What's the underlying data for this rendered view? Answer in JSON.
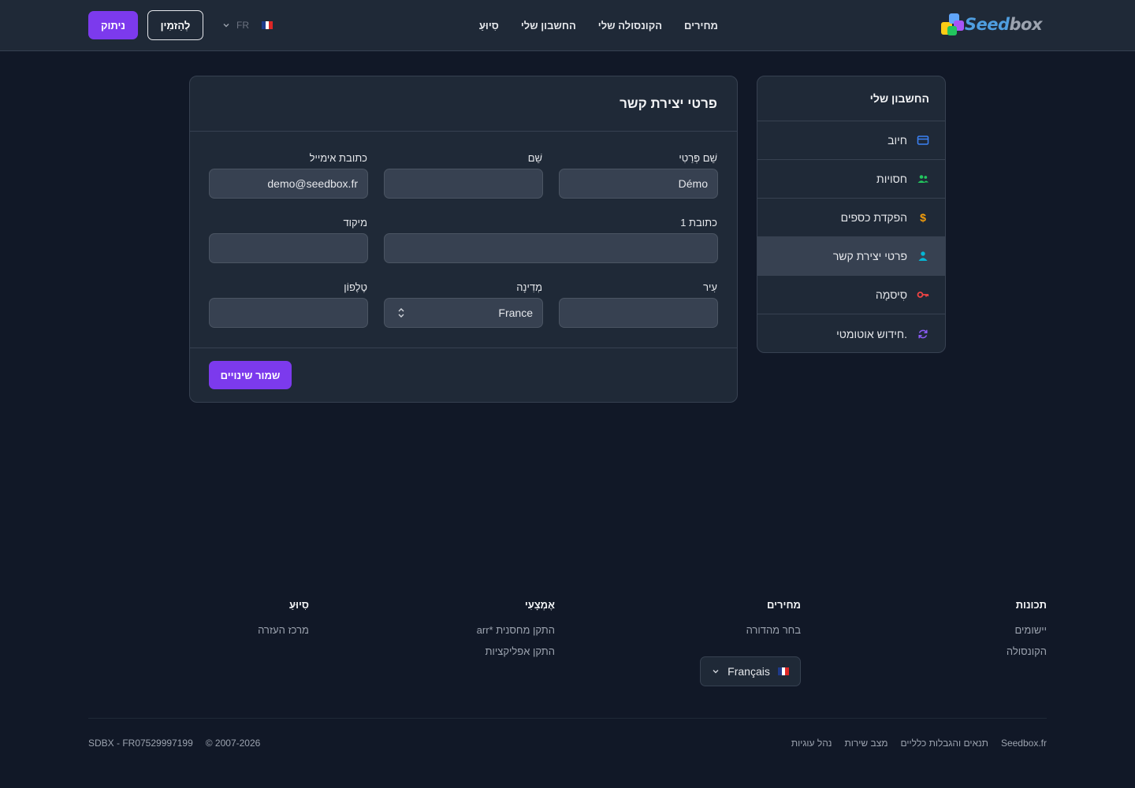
{
  "brand": {
    "logo_text_a": "Seed",
    "logo_text_b": "box"
  },
  "header": {
    "nav": [
      "מחירים",
      "הקונסולה שלי",
      "החשבון שלי",
      "סִיוּעַ"
    ],
    "login_label": "ניתוק",
    "order_label": "לְהַזמִין",
    "lang_code": "FR"
  },
  "sidebar": {
    "title": "החשבון שלי",
    "items": [
      {
        "label": "חיוב",
        "icon": "credit-card-icon",
        "color": "#3b82f6"
      },
      {
        "label": "חסויות",
        "icon": "users-icon",
        "color": "#22c55e"
      },
      {
        "label": "הפקדת כספים",
        "icon": "dollar-icon",
        "color": "#f59e0b"
      },
      {
        "label": "פרטי יצירת קשר",
        "icon": "user-icon",
        "color": "#06b6d4"
      },
      {
        "label": "סִיסמָה",
        "icon": "key-icon",
        "color": "#ef4444"
      },
      {
        "label": "חידוש אוטומטי.",
        "icon": "refresh-icon",
        "color": "#8b5cf6"
      }
    ],
    "active_index": 3
  },
  "form": {
    "title": "פרטי יצירת קשר",
    "first_name": {
      "label": "שֵׁם פְּרַטִי",
      "value": "Démo"
    },
    "last_name": {
      "label": "שֵׁם",
      "value": ""
    },
    "email": {
      "label": "כתובת אימייל",
      "value": "demo@seedbox.fr"
    },
    "address1": {
      "label": "כתובת 1",
      "value": ""
    },
    "zip": {
      "label": "מיקוד",
      "value": ""
    },
    "city": {
      "label": "עִיר",
      "value": ""
    },
    "country": {
      "label": "מְדִינָה",
      "value": "France"
    },
    "phone": {
      "label": "טֶלֶפוֹן",
      "value": ""
    },
    "save_label": "שמור שינויים"
  },
  "footer": {
    "features": {
      "title": "תכונות",
      "links": [
        "יישומים",
        "הקונסולה"
      ]
    },
    "pricing": {
      "title": "מחירים",
      "links": [
        "בחר מהדורה"
      ]
    },
    "resources": {
      "title": "אֶמְצָעִי",
      "links": [
        "התקן מחסנית *arr",
        "התקן אפליקציות"
      ]
    },
    "support": {
      "title": "סִיוּעַ",
      "links": [
        "מרכז העזרה"
      ]
    },
    "language_label": "Français",
    "bottom_links": [
      "Seedbox.fr",
      "תנאים והגבלות כלליים",
      "מצב שירות",
      "נהל עוגיות"
    ],
    "copyright": "© 2007-2026",
    "company": "SDBX - FR07529997199"
  }
}
